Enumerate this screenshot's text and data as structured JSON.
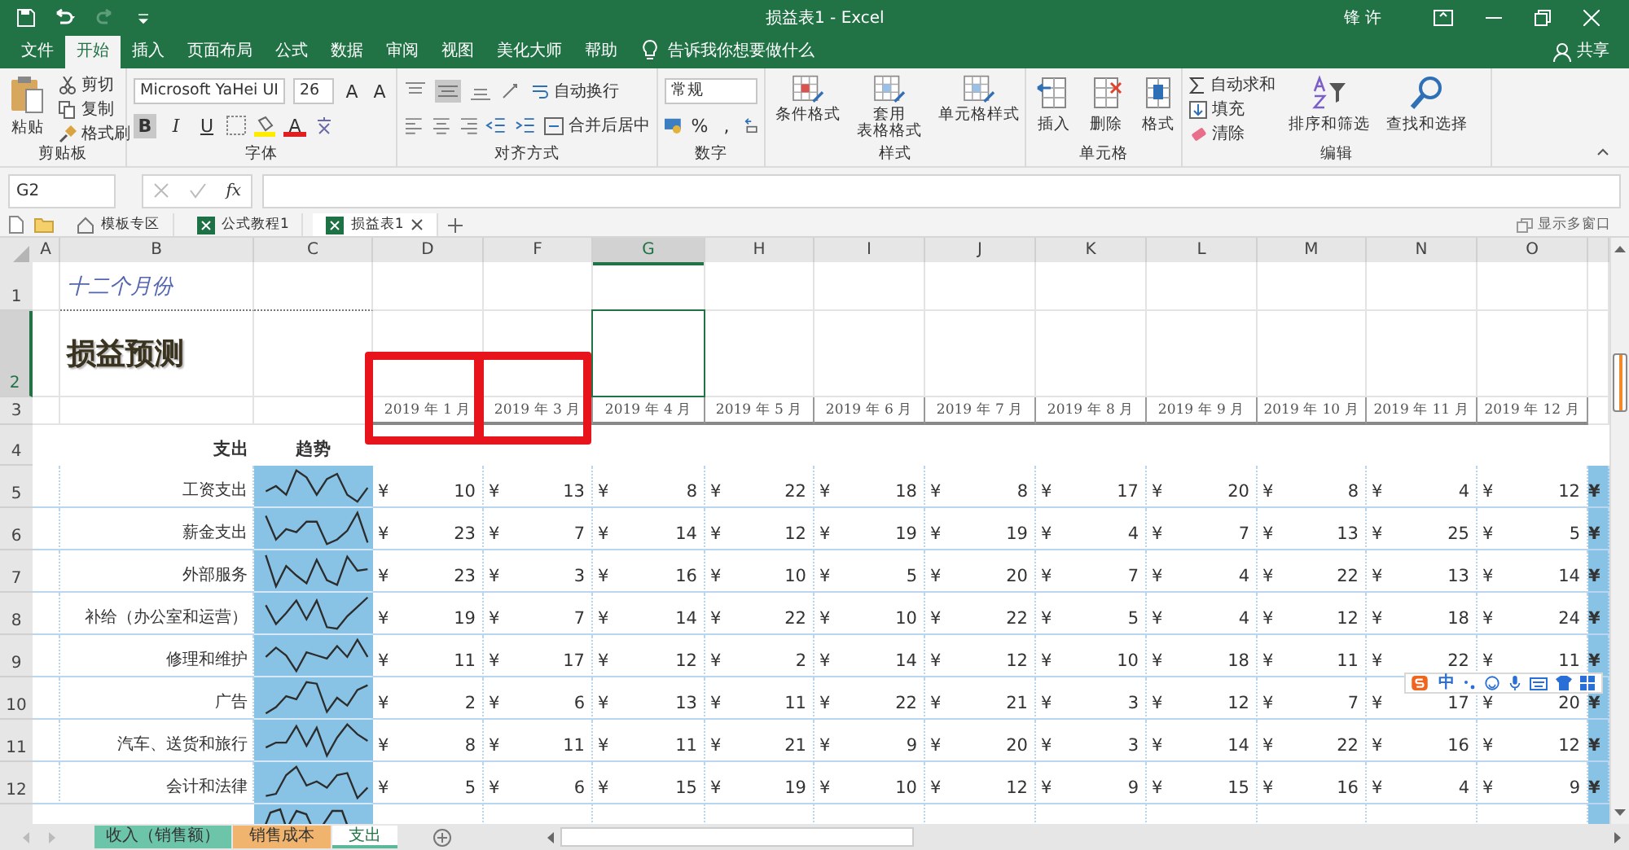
{
  "title_bar": {
    "title": "损益表1  -  Excel",
    "user": "锋 许"
  },
  "menu_tabs": [
    {
      "label": "文件",
      "selected": false
    },
    {
      "label": "开始",
      "selected": true
    },
    {
      "label": "插入",
      "selected": false
    },
    {
      "label": "页面布局",
      "selected": false
    },
    {
      "label": "公式",
      "selected": false
    },
    {
      "label": "数据",
      "selected": false
    },
    {
      "label": "审阅",
      "selected": false
    },
    {
      "label": "视图",
      "selected": false
    },
    {
      "label": "美化大师",
      "selected": false
    },
    {
      "label": "帮助",
      "selected": false
    }
  ],
  "tell_me": "告诉我你想要做什么",
  "share": "共享",
  "ribbon": {
    "clipboard": {
      "label": "剪贴板",
      "buttons": [
        "粘贴",
        "剪切",
        "复制",
        "格式刷"
      ]
    },
    "font": {
      "label": "字体",
      "font_name": "Microsoft YaHei UI",
      "font_size": "26",
      "glyphs": [
        "A",
        "A",
        "B",
        "I",
        "U",
        "A"
      ]
    },
    "alignment": {
      "label": "对齐方式",
      "buttons": [
        "自动换行",
        "合并后居中"
      ]
    },
    "number": {
      "label": "数字",
      "format": "常规",
      "glyphs": [
        "%",
        ","
      ]
    },
    "styles": {
      "label": "样式",
      "buttons": [
        {
          "lines": [
            "条件格式"
          ]
        },
        {
          "lines": [
            "套用",
            "表格格式"
          ]
        },
        {
          "lines": [
            "单元格样式"
          ]
        }
      ]
    },
    "cells": {
      "label": "单元格",
      "buttons": [
        "插入",
        "删除",
        "格式"
      ]
    },
    "editing": {
      "label": "编辑",
      "buttons": [
        "自动求和",
        "填充",
        "清除",
        "排序和筛选",
        "查找和选择"
      ]
    }
  },
  "formula_bar": {
    "name_box": "G2",
    "fx": "fx"
  },
  "workbook_tabs": [
    {
      "label": "模板专区",
      "selected": false
    },
    {
      "label": "公式教程1",
      "selected": false
    },
    {
      "label": "损益表1",
      "selected": true
    }
  ],
  "show_windows": "显示多窗口",
  "sheet": {
    "column_letters": [
      {
        "label": "A",
        "selected": false
      },
      {
        "label": "B",
        "selected": false
      },
      {
        "label": "C",
        "selected": false
      },
      {
        "label": "D",
        "selected": false
      },
      {
        "label": "F",
        "selected": false
      },
      {
        "label": "G",
        "selected": true
      },
      {
        "label": "H",
        "selected": false
      },
      {
        "label": "I",
        "selected": false
      },
      {
        "label": "J",
        "selected": false
      },
      {
        "label": "K",
        "selected": false
      },
      {
        "label": "L",
        "selected": false
      },
      {
        "label": "M",
        "selected": false
      },
      {
        "label": "N",
        "selected": false
      },
      {
        "label": "O",
        "selected": false
      }
    ],
    "row_headers": [
      {
        "label": "1",
        "selected": false
      },
      {
        "label": "2",
        "selected": true
      },
      {
        "label": "3",
        "selected": false
      },
      {
        "label": "4",
        "selected": false
      },
      {
        "label": "5",
        "selected": false
      },
      {
        "label": "6",
        "selected": false
      },
      {
        "label": "7",
        "selected": false
      },
      {
        "label": "8",
        "selected": false
      },
      {
        "label": "9",
        "selected": false
      },
      {
        "label": "10",
        "selected": false
      },
      {
        "label": "11",
        "selected": false
      },
      {
        "label": "12",
        "selected": false
      }
    ],
    "subtitle": "十二个月份",
    "heading": "损益预测",
    "months": [
      {
        "label": "2019 年 1 月",
        "highlighted": true
      },
      {
        "label": "2019 年 3 月",
        "highlighted": true
      },
      {
        "label": "2019 年 4 月",
        "highlighted": false
      },
      {
        "label": "2019 年 5 月",
        "highlighted": false
      },
      {
        "label": "2019 年 6 月",
        "highlighted": false
      },
      {
        "label": "2019 年 7 月",
        "highlighted": false
      },
      {
        "label": "2019 年 8 月",
        "highlighted": false
      },
      {
        "label": "2019 年 9 月",
        "highlighted": false
      },
      {
        "label": "2019 年 10 月",
        "highlighted": false
      },
      {
        "label": "2019 年 11 月",
        "highlighted": false
      },
      {
        "label": "2019 年 12 月",
        "highlighted": false
      }
    ],
    "label_header": "支出",
    "trend_header": "趋势",
    "rows": [
      {
        "label": "工资支出",
        "cells": [
          {
            "cur": "¥",
            "amt": "10"
          },
          {
            "cur": "¥",
            "amt": "13"
          },
          {
            "cur": "¥",
            "amt": "8"
          },
          {
            "cur": "¥",
            "amt": "22"
          },
          {
            "cur": "¥",
            "amt": "18"
          },
          {
            "cur": "¥",
            "amt": "8"
          },
          {
            "cur": "¥",
            "amt": "17"
          },
          {
            "cur": "¥",
            "amt": "20"
          },
          {
            "cur": "¥",
            "amt": "8"
          },
          {
            "cur": "¥",
            "amt": "4"
          },
          {
            "cur": "¥",
            "amt": "12"
          }
        ],
        "tail": "¥"
      },
      {
        "label": "薪金支出",
        "cells": [
          {
            "cur": "¥",
            "amt": "23"
          },
          {
            "cur": "¥",
            "amt": "7"
          },
          {
            "cur": "¥",
            "amt": "14"
          },
          {
            "cur": "¥",
            "amt": "12"
          },
          {
            "cur": "¥",
            "amt": "19"
          },
          {
            "cur": "¥",
            "amt": "19"
          },
          {
            "cur": "¥",
            "amt": "4"
          },
          {
            "cur": "¥",
            "amt": "7"
          },
          {
            "cur": "¥",
            "amt": "13"
          },
          {
            "cur": "¥",
            "amt": "25"
          },
          {
            "cur": "¥",
            "amt": "5"
          }
        ],
        "tail": "¥"
      },
      {
        "label": "外部服务",
        "cells": [
          {
            "cur": "¥",
            "amt": "23"
          },
          {
            "cur": "¥",
            "amt": "3"
          },
          {
            "cur": "¥",
            "amt": "16"
          },
          {
            "cur": "¥",
            "amt": "10"
          },
          {
            "cur": "¥",
            "amt": "5"
          },
          {
            "cur": "¥",
            "amt": "20"
          },
          {
            "cur": "¥",
            "amt": "7"
          },
          {
            "cur": "¥",
            "amt": "4"
          },
          {
            "cur": "¥",
            "amt": "22"
          },
          {
            "cur": "¥",
            "amt": "13"
          },
          {
            "cur": "¥",
            "amt": "14"
          }
        ],
        "tail": "¥"
      },
      {
        "label": "补给（办公室和运营）",
        "cells": [
          {
            "cur": "¥",
            "amt": "19"
          },
          {
            "cur": "¥",
            "amt": "7"
          },
          {
            "cur": "¥",
            "amt": "14"
          },
          {
            "cur": "¥",
            "amt": "22"
          },
          {
            "cur": "¥",
            "amt": "10"
          },
          {
            "cur": "¥",
            "amt": "22"
          },
          {
            "cur": "¥",
            "amt": "5"
          },
          {
            "cur": "¥",
            "amt": "4"
          },
          {
            "cur": "¥",
            "amt": "12"
          },
          {
            "cur": "¥",
            "amt": "18"
          },
          {
            "cur": "¥",
            "amt": "24"
          }
        ],
        "tail": "¥"
      },
      {
        "label": "修理和维护",
        "cells": [
          {
            "cur": "¥",
            "amt": "11"
          },
          {
            "cur": "¥",
            "amt": "17"
          },
          {
            "cur": "¥",
            "amt": "12"
          },
          {
            "cur": "¥",
            "amt": "2"
          },
          {
            "cur": "¥",
            "amt": "14"
          },
          {
            "cur": "¥",
            "amt": "12"
          },
          {
            "cur": "¥",
            "amt": "10"
          },
          {
            "cur": "¥",
            "amt": "18"
          },
          {
            "cur": "¥",
            "amt": "11"
          },
          {
            "cur": "¥",
            "amt": "22"
          },
          {
            "cur": "¥",
            "amt": "11"
          }
        ],
        "tail": "¥"
      },
      {
        "label": "广告",
        "cells": [
          {
            "cur": "¥",
            "amt": "2"
          },
          {
            "cur": "¥",
            "amt": "6"
          },
          {
            "cur": "¥",
            "amt": "13"
          },
          {
            "cur": "¥",
            "amt": "11"
          },
          {
            "cur": "¥",
            "amt": "22"
          },
          {
            "cur": "¥",
            "amt": "21"
          },
          {
            "cur": "¥",
            "amt": "3"
          },
          {
            "cur": "¥",
            "amt": "12"
          },
          {
            "cur": "¥",
            "amt": "7"
          },
          {
            "cur": "¥",
            "amt": "17"
          },
          {
            "cur": "¥",
            "amt": "20"
          }
        ],
        "tail": "¥"
      },
      {
        "label": "汽车、送货和旅行",
        "cells": [
          {
            "cur": "¥",
            "amt": "8"
          },
          {
            "cur": "¥",
            "amt": "11"
          },
          {
            "cur": "¥",
            "amt": "11"
          },
          {
            "cur": "¥",
            "amt": "21"
          },
          {
            "cur": "¥",
            "amt": "9"
          },
          {
            "cur": "¥",
            "amt": "20"
          },
          {
            "cur": "¥",
            "amt": "3"
          },
          {
            "cur": "¥",
            "amt": "14"
          },
          {
            "cur": "¥",
            "amt": "22"
          },
          {
            "cur": "¥",
            "amt": "16"
          },
          {
            "cur": "¥",
            "amt": "12"
          }
        ],
        "tail": "¥"
      },
      {
        "label": "会计和法律",
        "cells": [
          {
            "cur": "¥",
            "amt": "5"
          },
          {
            "cur": "¥",
            "amt": "6"
          },
          {
            "cur": "¥",
            "amt": "15"
          },
          {
            "cur": "¥",
            "amt": "19"
          },
          {
            "cur": "¥",
            "amt": "10"
          },
          {
            "cur": "¥",
            "amt": "12"
          },
          {
            "cur": "¥",
            "amt": "9"
          },
          {
            "cur": "¥",
            "amt": "15"
          },
          {
            "cur": "¥",
            "amt": "16"
          },
          {
            "cur": "¥",
            "amt": "4"
          },
          {
            "cur": "¥",
            "amt": "9"
          }
        ],
        "tail": "¥"
      }
    ]
  },
  "ime_toolbar": {
    "label": "中"
  },
  "sheet_tabs": [
    {
      "label": "收入（销售额）",
      "selected": false,
      "color": "#6cc4a9"
    },
    {
      "label": "销售成本",
      "selected": false,
      "color": "#f0b46e"
    },
    {
      "label": "支出",
      "selected": true,
      "color": "#5cb89b"
    }
  ]
}
